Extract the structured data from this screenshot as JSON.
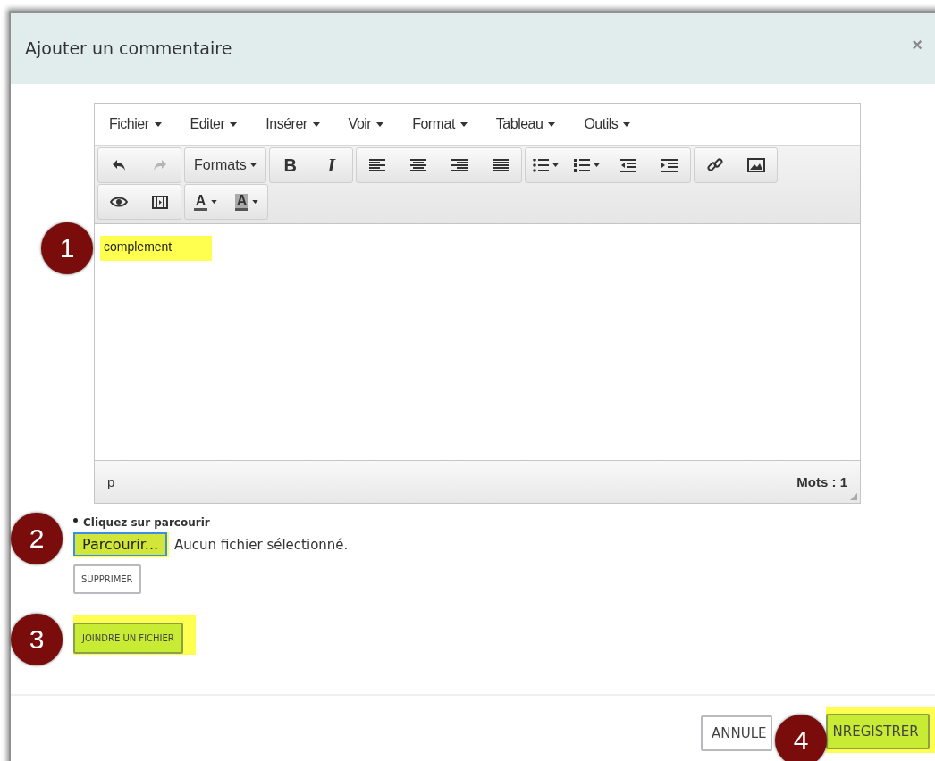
{
  "dialog": {
    "title": "Ajouter un commentaire",
    "close": "×"
  },
  "editor": {
    "menu": [
      {
        "label": "Fichier"
      },
      {
        "label": "Editer"
      },
      {
        "label": "Insérer"
      },
      {
        "label": "Voir"
      },
      {
        "label": "Format"
      },
      {
        "label": "Tableau"
      },
      {
        "label": "Outils"
      }
    ],
    "toolbar": [
      [
        [
          {
            "kind": "undo",
            "disabled": false
          },
          {
            "kind": "redo",
            "disabled": true
          }
        ],
        [
          {
            "kind": "dropdown",
            "label": "Formats",
            "caret": true
          }
        ],
        [
          {
            "kind": "bold",
            "label": "B"
          },
          {
            "kind": "italic",
            "label": "I"
          }
        ],
        [
          {
            "kind": "align-left"
          },
          {
            "kind": "align-center"
          },
          {
            "kind": "align-right"
          },
          {
            "kind": "justify"
          }
        ],
        [
          {
            "kind": "bullet-list",
            "caret": true
          },
          {
            "kind": "numbered-list",
            "caret": true
          },
          {
            "kind": "outdent"
          },
          {
            "kind": "indent"
          }
        ],
        [
          {
            "kind": "link"
          },
          {
            "kind": "image"
          }
        ]
      ],
      [
        [
          {
            "kind": "preview"
          },
          {
            "kind": "media"
          }
        ],
        [
          {
            "kind": "text-color",
            "label": "A",
            "caret": true
          },
          {
            "kind": "background-color",
            "label": "A",
            "caret": true
          }
        ]
      ]
    ],
    "content": {
      "text": "complement",
      "highlighted": true
    },
    "path": "p",
    "word_count": "Mots : 1"
  },
  "attachment": {
    "hint": "Cliquez sur parcourir",
    "browse": {
      "label": "Parcourir...",
      "highlighted": true
    },
    "file_status": "Aucun fichier sélectionné.",
    "remove": {
      "label": "SUPPRIMER",
      "highlighted": false
    },
    "attach": {
      "label": "JOINDRE UN FICHIER",
      "highlighted": true
    }
  },
  "footer": {
    "cancel": {
      "label": "ANNULE",
      "highlighted": false
    },
    "save": {
      "label": "NREGISTRER",
      "highlighted": true
    }
  },
  "callouts": [
    "1",
    "2",
    "3",
    "4"
  ]
}
